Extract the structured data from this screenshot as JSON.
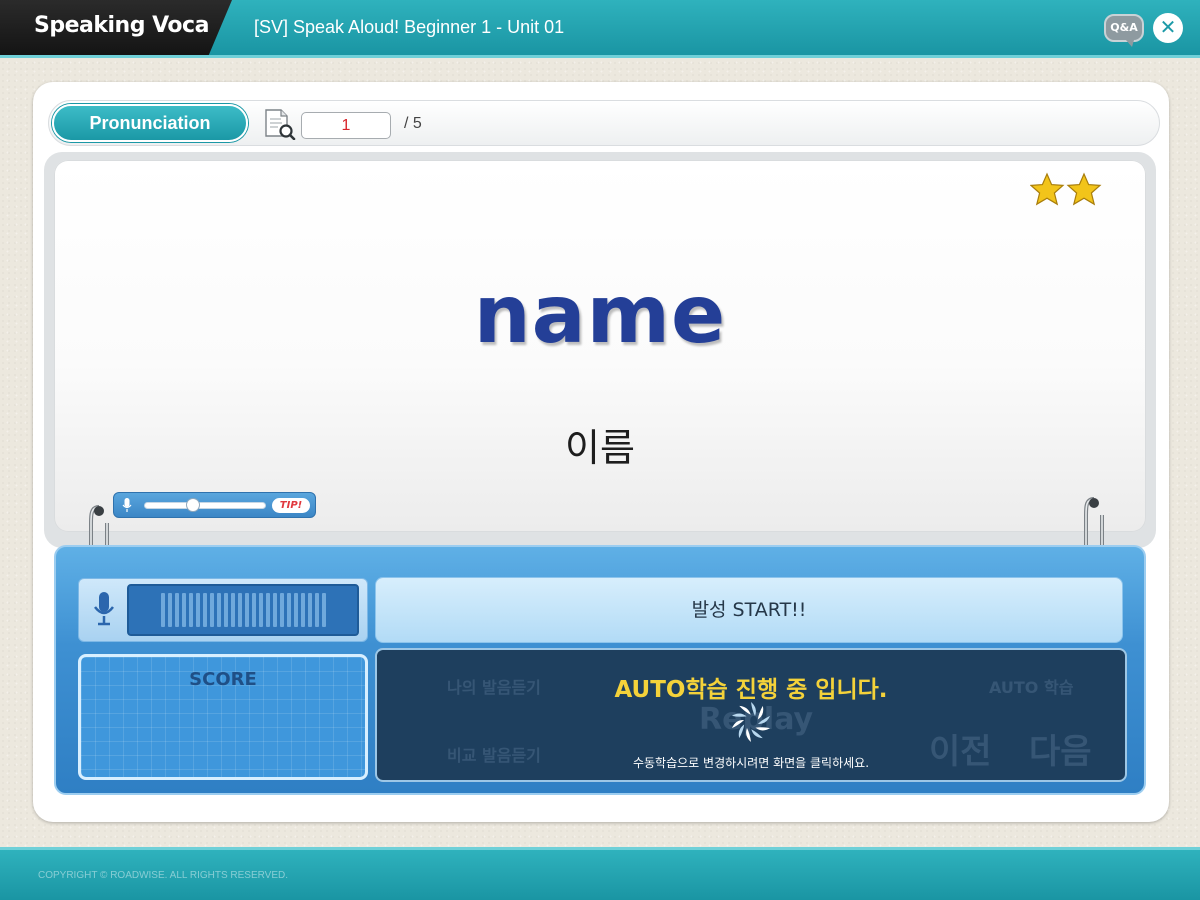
{
  "header": {
    "app_name": "Speaking Voca",
    "unit_title": "[SV] Speak Aloud! Beginner 1 - Unit 01",
    "qa_label": "Q&A",
    "close_symbol": "✕"
  },
  "toolbar": {
    "mode_label": "Pronunciation",
    "current_page": "1",
    "total_pages": "/ 5",
    "icon": "document-search-icon"
  },
  "card": {
    "word": "name",
    "meaning": "이름",
    "stars": 2,
    "tip_label": "TIP!"
  },
  "controls": {
    "start_label": "발성 START!!",
    "score_label": "SCORE",
    "auto_title": "AUTO학습 진행 중 입니다.",
    "auto_subtitle": "수동학습으로 변경하시려면 화면을 클릭하세요.",
    "hidden_buttons": {
      "my_pronunciation": "나의 발음듣기",
      "compare": "비교 발음듣기",
      "auto_study": "AUTO 학습",
      "replay": "Replay",
      "previous": "이전",
      "next": "다음"
    },
    "volume_level": 0.38
  },
  "footer": {
    "copyright": "COPYRIGHT © ROADWISE. ALL RIGHTS RESERVED."
  },
  "colors": {
    "teal": "#1a95a3",
    "word_blue": "#243f97",
    "auto_yellow": "#f4d23a",
    "control_blue": "#3e90d2"
  }
}
